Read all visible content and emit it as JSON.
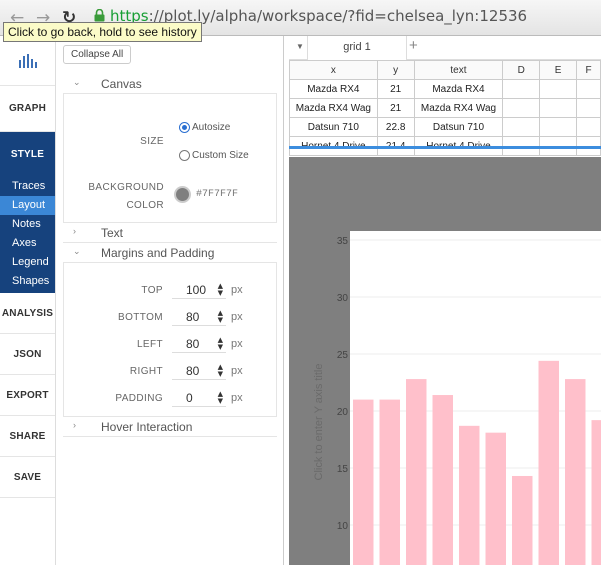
{
  "browser": {
    "back": "←",
    "forward": "→",
    "reload": "↻",
    "url_scheme": "https",
    "url_rest": "://plot.ly/alpha/workspace/?fid=chelsea_lyn:12536",
    "tooltip": "Click to go back, hold to see history",
    "secure_color": "#179e33"
  },
  "nav": {
    "graph": "GRAPH",
    "style": "STYLE",
    "sub": [
      "Traces",
      "Layout",
      "Notes",
      "Axes",
      "Legend",
      "Shapes"
    ],
    "analysis": "ANALYSIS",
    "json": "JSON",
    "export": "EXPORT",
    "share": "SHARE",
    "save": "SAVE",
    "accent_color": "#16427d",
    "active_sub_color": "#3b87d6"
  },
  "panel": {
    "collapse_all": "Collapse All",
    "canvas": {
      "title": "Canvas",
      "size_label": "SIZE",
      "autosize": "Autosize",
      "custom_size": "Custom Size",
      "selected": "Autosize",
      "bg_label_1": "BACKGROUND",
      "bg_label_2": "COLOR",
      "bg_color": "#7F7F7F"
    },
    "text": {
      "title": "Text"
    },
    "margins": {
      "title": "Margins and Padding",
      "top_label": "TOP",
      "top": "100",
      "bottom_label": "BOTTOM",
      "bottom": "80",
      "left_label": "LEFT",
      "left": "80",
      "right_label": "RIGHT",
      "right": "80",
      "padding_label": "PADDING",
      "padding": "0",
      "unit": "px"
    },
    "hover": {
      "title": "Hover Interaction"
    }
  },
  "grid": {
    "tab": "grid 1",
    "add": "+",
    "columns": [
      "x",
      "y",
      "text",
      "D",
      "E",
      "F"
    ],
    "rows": [
      [
        "Mazda RX4",
        "21",
        "Mazda RX4",
        "",
        "",
        ""
      ],
      [
        "Mazda RX4 Wag",
        "21",
        "Mazda RX4 Wag",
        "",
        "",
        ""
      ],
      [
        "Datsun 710",
        "22.8",
        "Datsun 710",
        "",
        "",
        ""
      ],
      [
        "Hornet 4 Drive",
        "21.4",
        "Hornet 4 Drive",
        "",
        "",
        ""
      ]
    ],
    "selection_color": "#3c8dde"
  },
  "chart_data": {
    "type": "bar",
    "ylabel": "Click to enter Y axis title",
    "yticks": [
      10,
      15,
      20,
      25,
      30,
      35
    ],
    "values": [
      21,
      21,
      22.8,
      21.4,
      18.7,
      18.1,
      14.3,
      24.4,
      22.8,
      19.2
    ],
    "bar_color": "#ffc0cb",
    "paper_bg": "#7f7f7f",
    "plot_bg": "#ffffff",
    "grid": true
  }
}
